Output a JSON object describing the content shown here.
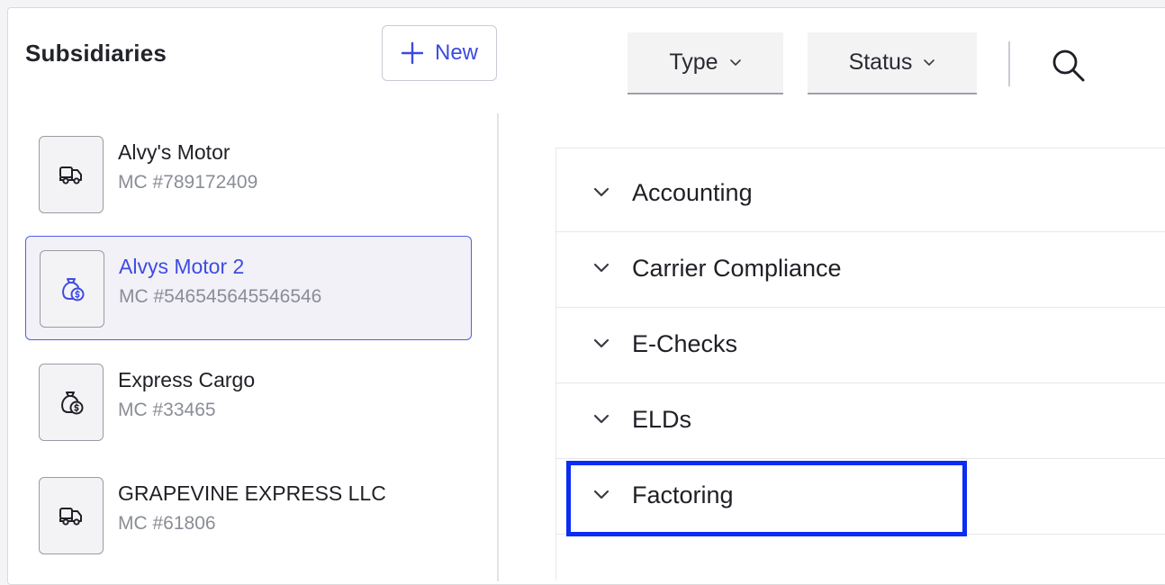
{
  "header": {
    "title": "Subsidiaries",
    "new_button_label": "New"
  },
  "filters": {
    "type_label": "Type",
    "status_label": "Status"
  },
  "subsidiaries": [
    {
      "name": "Alvy's Motor",
      "mc": "MC #789172409",
      "icon": "truck-icon",
      "selected": false
    },
    {
      "name": "Alvys Motor 2",
      "mc": "MC #546545645546546",
      "icon": "money-bag-icon",
      "selected": true
    },
    {
      "name": "Express Cargo",
      "mc": "MC #33465",
      "icon": "money-bag-icon",
      "selected": false
    },
    {
      "name": "GRAPEVINE EXPRESS LLC",
      "mc": "MC #61806",
      "icon": "truck-icon",
      "selected": false
    }
  ],
  "sections": [
    {
      "label": "Accounting"
    },
    {
      "label": "Carrier Compliance"
    },
    {
      "label": "E-Checks"
    },
    {
      "label": "ELDs"
    },
    {
      "label": "Factoring"
    }
  ],
  "colors": {
    "accent": "#3f4ce0",
    "highlight_border": "#0a2cf5",
    "selected_background": "#f1f1f7"
  }
}
